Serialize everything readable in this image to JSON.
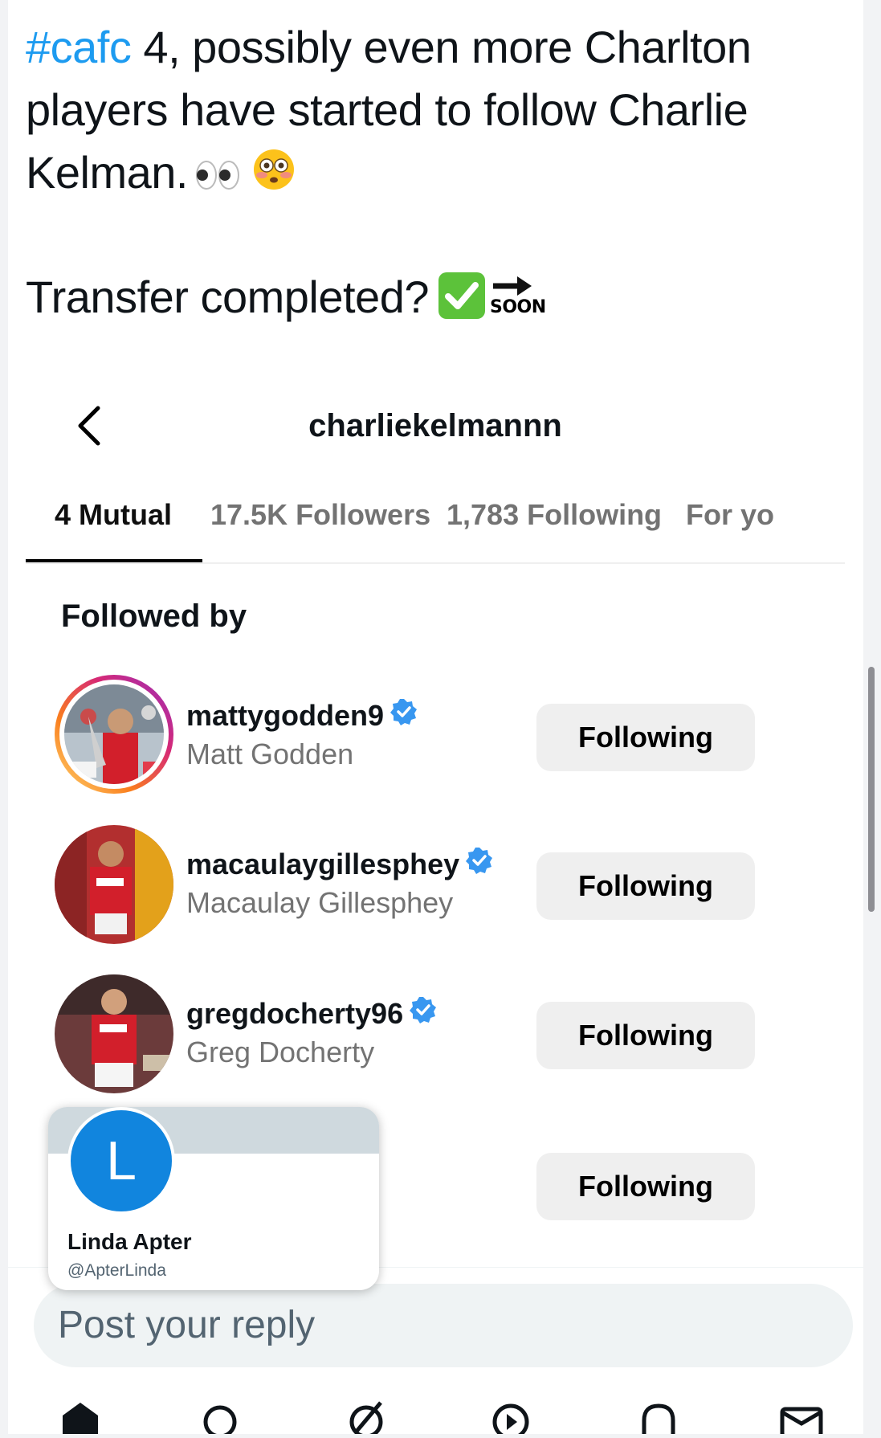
{
  "tweet": {
    "hashtag": "#cafc",
    "text": " 4, possibly even more Charlton players have started to follow Charlie Kelman.",
    "line2": "Transfer completed?",
    "soon_label": "SOON"
  },
  "instagram": {
    "profile_username": "charliekelmannn",
    "tabs": [
      {
        "label": "4 Mutual",
        "active": true
      },
      {
        "label": "17.5K Followers",
        "active": false
      },
      {
        "label": "1,783 Following",
        "active": false
      },
      {
        "label": "For yo",
        "active": false
      }
    ],
    "section_label": "Followed by",
    "users": [
      {
        "username": "mattygodden9",
        "name": "Matt Godden",
        "verified": true,
        "button": "Following"
      },
      {
        "username": "macaulaygillespheу",
        "name": "Macaulay Gillesphey",
        "verified": true,
        "button": "Following"
      },
      {
        "username": "gregdocherty96",
        "name": "Greg Docherty",
        "verified": true,
        "button": "Following"
      },
      {
        "username": "",
        "name": "",
        "verified": false,
        "button": "Following"
      }
    ]
  },
  "hover_card": {
    "avatar_letter": "L",
    "name": "Linda Apter",
    "handle": "@ApterLinda"
  },
  "reply": {
    "placeholder": "Post your reply"
  },
  "bottom_nav": [
    "home-icon",
    "search-icon",
    "grok-icon",
    "video-icon",
    "notifications-icon",
    "messages-icon"
  ],
  "colors": {
    "link_blue": "#1d9bf0",
    "verified_blue": "#3897f0",
    "hover_avatar_blue": "#1185de",
    "button_gray": "#efefef"
  }
}
